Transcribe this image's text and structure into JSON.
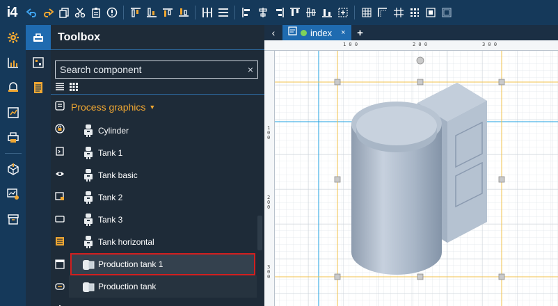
{
  "app": {
    "logo": "i4"
  },
  "toolbar_icons": [
    "undo-icon",
    "redo-icon",
    "copy-icon",
    "cut-icon",
    "paste-icon",
    "delete-icon",
    "align-top-icon",
    "align-bottom-icon",
    "align-middle-top-icon",
    "align-middle-bottom-icon",
    "distribute-horizontal-icon",
    "distribute-vertical-icon",
    "align-left-icon",
    "align-center-icon",
    "align-right-icon",
    "align-top-edge-icon",
    "align-center-edge-icon",
    "align-bottom-edge-icon",
    "align-group-icon",
    "grid-icon",
    "snap-icon",
    "grid-lines-icon",
    "grid-dots-icon",
    "guides-icon",
    "frame-icon"
  ],
  "left_rail": [
    "settings-icon",
    "chart-icon",
    "alarm-icon",
    "report-icon",
    "printer-icon",
    "package-icon",
    "trend-settings-icon",
    "archive-icon"
  ],
  "second_rail": [
    "toolbox-icon",
    "components-icon",
    "document-icon"
  ],
  "toolbox": {
    "title": "Toolbox",
    "search_value": "Search component",
    "clear_label": "×",
    "category": {
      "label": "Process graphics",
      "caret": "▼"
    },
    "items": [
      {
        "label": "Cylinder",
        "icon": "robot-icon"
      },
      {
        "label": "Tank 1",
        "icon": "robot-icon"
      },
      {
        "label": "Tank basic",
        "icon": "robot-icon"
      },
      {
        "label": "Tank 2",
        "icon": "robot-icon"
      },
      {
        "label": "Tank 3",
        "icon": "robot-icon"
      },
      {
        "label": "Tank horizontal",
        "icon": "robot-icon"
      },
      {
        "label": "Production tank 1",
        "icon": "production-tank-icon"
      },
      {
        "label": "Production tank",
        "icon": "production-tank-icon"
      }
    ]
  },
  "tabs": {
    "back": "‹",
    "active": {
      "label": "index",
      "close": "×"
    },
    "add": "+"
  },
  "rulers": {
    "top": [
      "1 0 0",
      "2 0 0",
      "3 0 0"
    ],
    "left": [
      "1 0 0",
      "2 0 0",
      "3 0 0"
    ]
  },
  "colors": {
    "accent": "#1f6bb0",
    "category": "#f0a732",
    "selection_outline": "#d21f1f",
    "guide_blue": "#1da1e0",
    "guide_yellow": "#f0c24a"
  }
}
